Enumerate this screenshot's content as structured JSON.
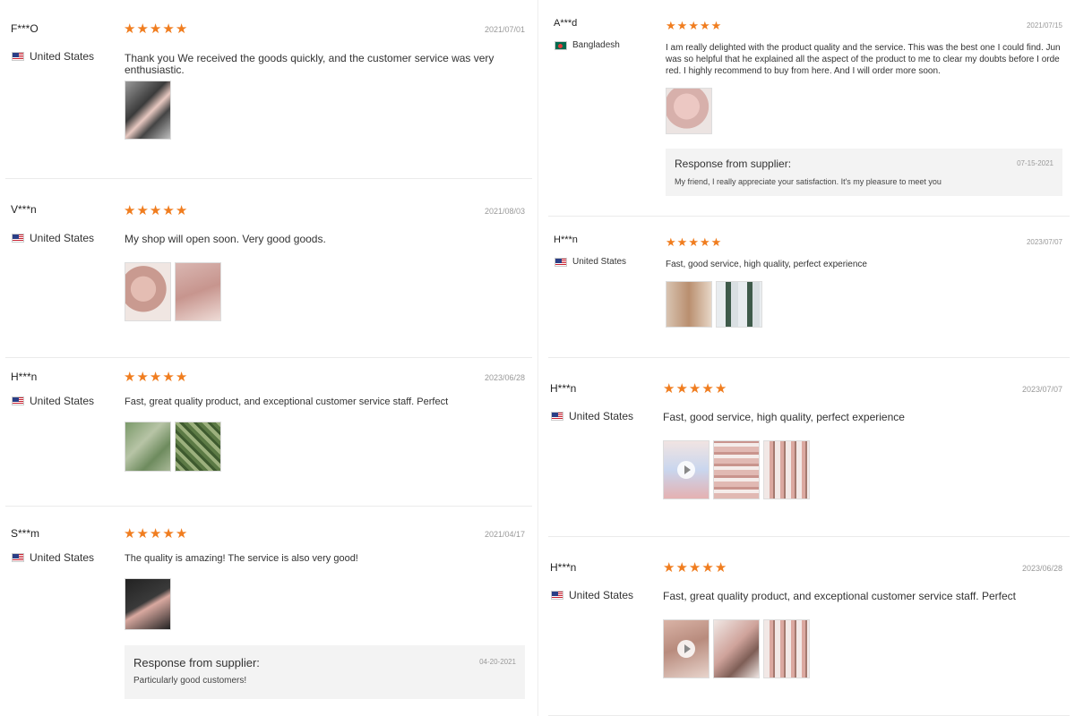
{
  "left_reviews": [
    {
      "user": "F***O",
      "country": "United States",
      "flag": "us",
      "stars": 5,
      "date": "2021/07/01",
      "text": "Thank you We received the goods quickly, and the customer service was very enthusiastic.",
      "thumbs": [
        "t-dark"
      ]
    },
    {
      "user": "V***n",
      "country": "United States",
      "flag": "us",
      "stars": 5,
      "date": "2021/08/03",
      "text": "My shop will open soon. Very good goods.",
      "thumbs": [
        "t-pinkhand",
        "t-pink"
      ]
    },
    {
      "user": "H***n",
      "country": "United States",
      "flag": "us",
      "stars": 5,
      "date": "2023/06/28",
      "text": "Fast, great quality product, and exceptional customer service staff. Perfect",
      "thumbs": [
        "t-green",
        "t-greenleaf"
      ]
    },
    {
      "user": "S***m",
      "country": "United States",
      "flag": "us",
      "stars": 5,
      "date": "2021/04/17",
      "text": "The quality is amazing! The service is also very good!",
      "thumbs": [
        "t-blackpink"
      ],
      "reply": {
        "title": "Response from supplier:",
        "date": "04-20-2021",
        "text": "Particularly good customers!"
      }
    }
  ],
  "right_reviews": [
    {
      "user": "A***d",
      "country": "Bangladesh",
      "flag": "bd",
      "stars": 5,
      "date": "2021/07/15",
      "text_lines": [
        "I am really delighted with the product quality and the service. This was the best one I could find. Jun",
        "was so helpful that he explained all the aspect of the product to me to clear my doubts before I orde",
        "red. I highly recommend to buy from here. And I will order more soon."
      ],
      "thumbs": [
        "t-heart"
      ],
      "reply": {
        "title": "Response from supplier:",
        "date": "07-15-2021",
        "text": "My friend, I really appreciate your satisfaction. It's my pleasure to meet you"
      }
    },
    {
      "user": "H***n",
      "country": "United States",
      "flag": "us",
      "stars": 5,
      "date": "2023/07/07",
      "text": "Fast, good service, high quality, perfect experience",
      "thumbs": [
        "t-box",
        "t-jade"
      ]
    },
    {
      "user": "H***n",
      "country": "United States",
      "flag": "us",
      "stars": 5,
      "date": "2023/07/07",
      "text": "Fast, good service, high quality, perfect experience",
      "thumbs": [
        "t-video1",
        "t-rows",
        "t-rollers"
      ]
    },
    {
      "user": "H***n",
      "country": "United States",
      "flag": "us",
      "stars": 5,
      "date": "2023/06/28",
      "text": "Fast, great quality product, and exceptional customer service staff. Perfect",
      "thumbs": [
        "t-video2",
        "t-box2",
        "t-rollers"
      ]
    }
  ],
  "star_glyph": "★",
  "star_color": "#f07d1f"
}
